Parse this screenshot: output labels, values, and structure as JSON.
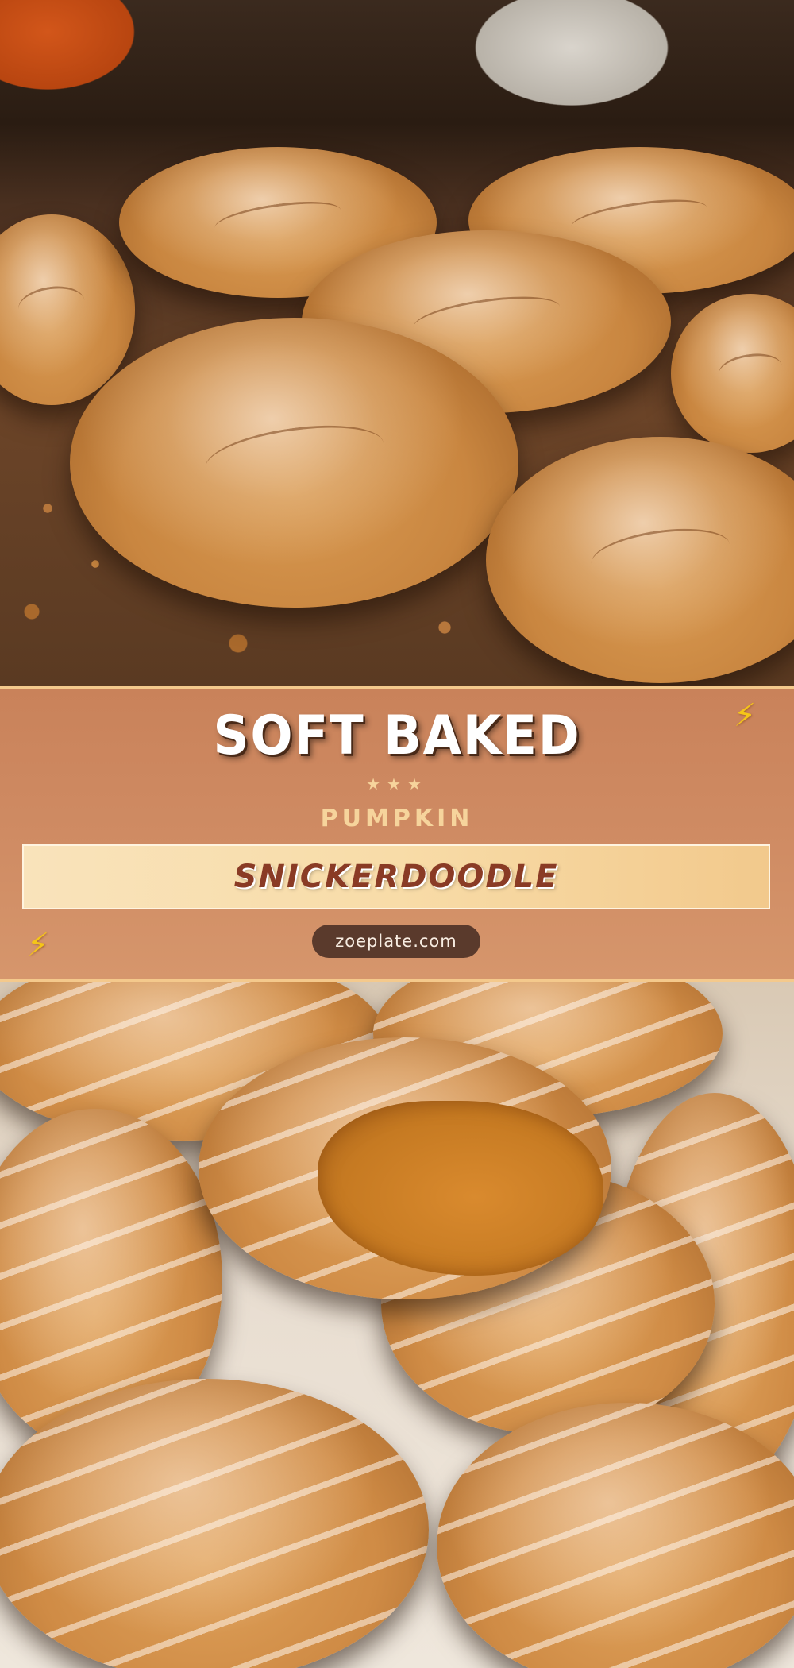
{
  "banner": {
    "title_line1": "SOFT BAKED",
    "stars": "★★★",
    "title_line2": "PUMPKIN",
    "title_line3": "SNICKERDOODLE",
    "website": "zoeplate.com",
    "decor_icon": "lightning-bolt-icon",
    "colors": {
      "banner_bg": "#cf8b63",
      "ribbon_bg": "#f8dca8",
      "accent_text": "#f6d49c",
      "ribbon_text": "#8a3b25",
      "pill_bg": "#5a3a2c",
      "bolt": "#f5c518"
    }
  },
  "photos": {
    "top_subject": "cinnamon-sugar pumpkin snickerdoodle cookies on a dark baking sheet",
    "bottom_subject": "stacked glazed pumpkin cookies with one bitten cookie"
  }
}
